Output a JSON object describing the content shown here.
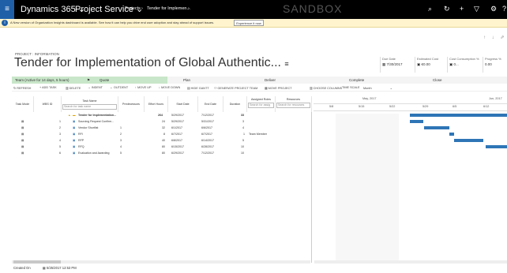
{
  "topbar": {
    "waffle_icon": "≡",
    "app": "Dynamics 365",
    "module": "Project Service",
    "breadcrumb_projects": "Projects",
    "breadcrumb_record": "Tender for Implemen...",
    "sandbox": "SANDBOX",
    "icons": [
      "search-icon",
      "history-icon",
      "plus-icon",
      "filter-icon",
      "gear-icon",
      "help-icon"
    ]
  },
  "notification": {
    "text": "A New version of Organization Insights dashboard is available. See how it can help you drive end user adoption and stay ahead of support issues.",
    "button": "Experience it now"
  },
  "record": {
    "type": "PROJECT : INFORMATION",
    "title": "Tender for Implementation of Global Authentic...",
    "fields": [
      {
        "label": "Due Date",
        "value": "7/30/2017"
      },
      {
        "label": "Estimated Cost",
        "value": "€0.00"
      },
      {
        "label": "Cost Consumption %",
        "value": "0..."
      },
      {
        "label": "Progress %",
        "value": "0.00"
      }
    ]
  },
  "process": {
    "active": "Team (Active for 14 days, 5 hours)",
    "stages": [
      "Quote",
      "Plan",
      "Deliver",
      "Complete",
      "Close"
    ]
  },
  "commands": [
    "REFRESH",
    "ADD TASK",
    "DELETE",
    "INDENT",
    "OUTDENT",
    "MOVE UP",
    "MOVE DOWN",
    "HIDE GANTT",
    "GENERATE PROJECT TEAM",
    "MOVE PROJECT",
    "CHOOSE COLUMNS",
    "TIME SCALE",
    "Month"
  ],
  "grid": {
    "headers": [
      "Task Mode",
      "WBS ID",
      "Task Name",
      "Predecessors",
      "Effort Hours",
      "Start Date",
      "End Date",
      "Duration",
      "Assigned Roles",
      "Resources"
    ],
    "search_task": "Search for task name",
    "search_roles": "Search for assig",
    "search_resources": "Search for resources",
    "rows": [
      {
        "wbs": "",
        "name": "Tender for Implementation...",
        "pred": "",
        "effort": "264",
        "start": "5/29/2017",
        "end": "7/12/2017",
        "duration": "33",
        "roles": "",
        "summary": true
      },
      {
        "wbs": "1",
        "name": "Sourcing Request Confirm...",
        "pred": "",
        "effort": "24",
        "start": "5/29/2017",
        "end": "5/31/2017",
        "duration": "3",
        "roles": ""
      },
      {
        "wbs": "2",
        "name": "Vendor Shortlist",
        "pred": "1",
        "effort": "32",
        "start": "6/1/2017",
        "end": "6/6/2017",
        "duration": "4",
        "roles": ""
      },
      {
        "wbs": "3",
        "name": "RFI",
        "pred": "2",
        "effort": "8",
        "start": "6/7/2017",
        "end": "6/7/2017",
        "duration": "1",
        "roles": "Team Member"
      },
      {
        "wbs": "4",
        "name": "RFP",
        "pred": "3",
        "effort": "40",
        "start": "6/8/2017",
        "end": "6/14/2017",
        "duration": "5",
        "roles": ""
      },
      {
        "wbs": "5",
        "name": "RFQ",
        "pred": "4",
        "effort": "80",
        "start": "6/15/2017",
        "end": "6/28/2017",
        "duration": "10",
        "roles": ""
      },
      {
        "wbs": "6",
        "name": "Evaluation and Awarding",
        "pred": "5",
        "effort": "80",
        "start": "6/29/2017",
        "end": "7/12/2017",
        "duration": "10",
        "roles": ""
      }
    ]
  },
  "gantt": {
    "months": [
      "May, 2017",
      "Jun, 2017"
    ],
    "days": [
      "5/8",
      "5/15",
      "5/22",
      "5/29",
      "6/5",
      "6/12"
    ],
    "bar_color": "#2e75b6"
  },
  "footer": {
    "label": "Created On",
    "value": "5/25/2017  12:53 PM"
  }
}
